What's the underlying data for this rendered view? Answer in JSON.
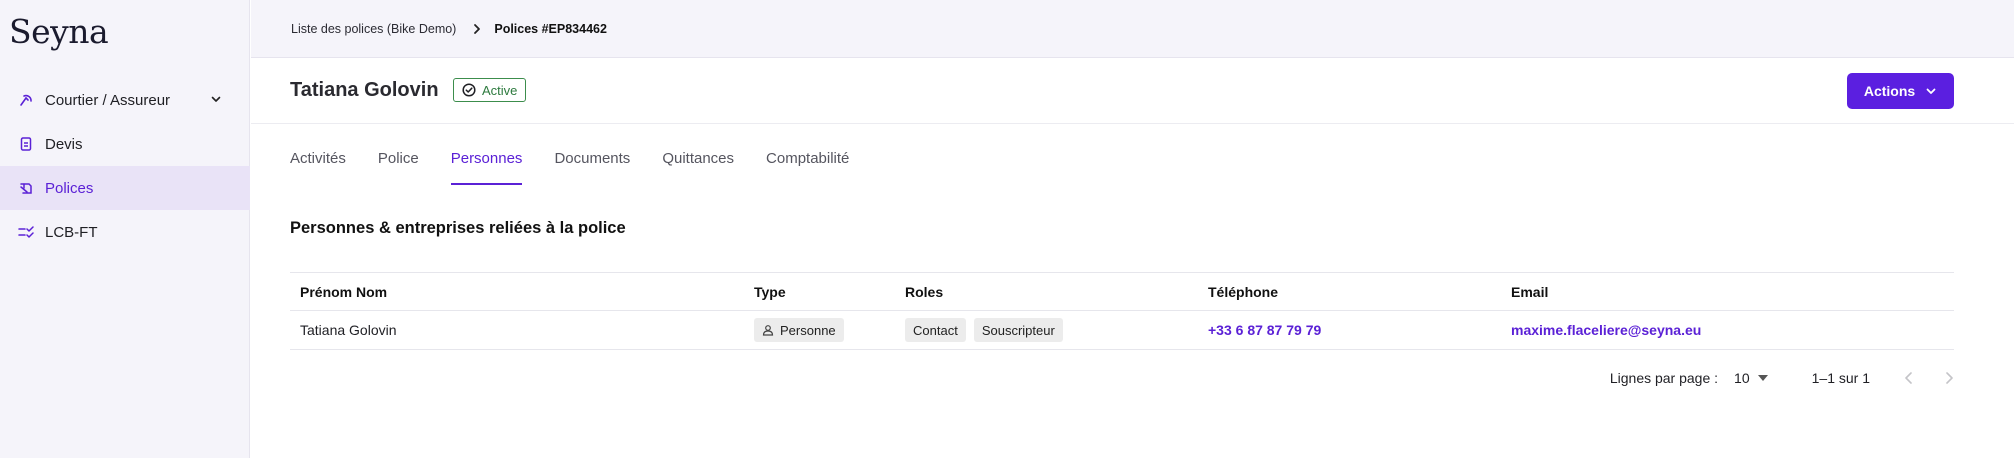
{
  "app": {
    "logo": "Seyna",
    "accent": "#5b21d6"
  },
  "sidebar": {
    "items": [
      {
        "label": "Courtier / Assureur",
        "icon": "broker-icon",
        "expandable": true
      },
      {
        "label": "Devis",
        "icon": "document-icon"
      },
      {
        "label": "Polices",
        "icon": "policy-icon",
        "active": true
      },
      {
        "label": "LCB-FT",
        "icon": "checklist-icon"
      }
    ]
  },
  "breadcrumb": {
    "parent": "Liste des polices (Bike Demo)",
    "current": "Polices #EP834462"
  },
  "header": {
    "name": "Tatiana Golovin",
    "status": "Active",
    "actions_label": "Actions"
  },
  "tabs": [
    {
      "label": "Activités"
    },
    {
      "label": "Police"
    },
    {
      "label": "Personnes",
      "active": true
    },
    {
      "label": "Documents"
    },
    {
      "label": "Quittances"
    },
    {
      "label": "Comptabilité"
    }
  ],
  "section_title": "Personnes & entreprises reliées à la police",
  "table": {
    "columns": [
      "Prénom Nom",
      "Type",
      "Roles",
      "Téléphone",
      "Email"
    ],
    "rows": [
      {
        "name": "Tatiana Golovin",
        "type": "Personne",
        "roles": [
          "Contact",
          "Souscripteur"
        ],
        "phone": "+33 6 87 87 79 79",
        "email": "maxime.flaceliere@seyna.eu"
      }
    ]
  },
  "pagination": {
    "rows_label": "Lignes par page :",
    "rows_value": "10",
    "range": "1–1 sur 1"
  }
}
